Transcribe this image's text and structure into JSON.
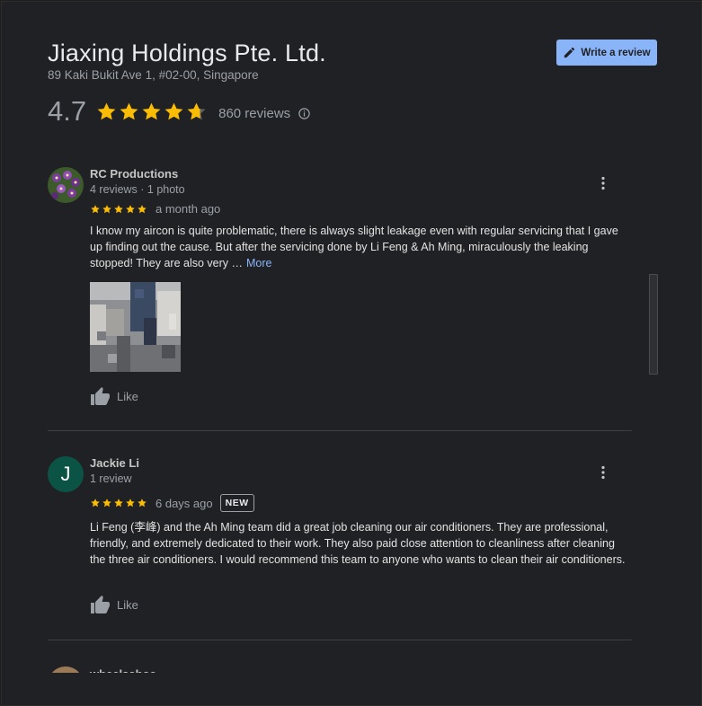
{
  "business": {
    "name": "Jiaxing Holdings Pte. Ltd.",
    "address": "89 Kaki Bukit Ave 1, #02-00, Singapore",
    "rating": "4.7",
    "rating_value": 4.7,
    "review_count": "860 reviews",
    "write_review_label": "Write a review"
  },
  "colors": {
    "star": "#fbbc04",
    "accent": "#8ab4f8",
    "background": "#202124"
  },
  "reviews": [
    {
      "name": "RC Productions",
      "meta": "4 reviews · 1 photo",
      "stars": 5,
      "date": "a month ago",
      "text": "I know my aircon is quite problematic, there is always slight leakage even with regular servicing that I gave up finding out the cause. But after the servicing done by Li Feng & Ah Ming, miraculously the leaking stopped! They are also very …",
      "more_label": "More",
      "like_label": "Like",
      "avatar": "flower-photo"
    },
    {
      "name": "Jackie Li",
      "meta": "1 review",
      "stars": 5,
      "date": "6 days ago",
      "badge": "NEW",
      "avatar_letter": "J",
      "text": "Li Feng (李峰) and the Ah Ming team did a great job cleaning our air conditioners. They are professional, friendly, and extremely dedicated to their work. They also paid close attention to cleanliness after cleaning the three air conditioners. I would recommend this team to anyone who wants to clean their air conditioners.",
      "like_label": "Like"
    },
    {
      "name": "wheelsahoe"
    }
  ],
  "icons": {
    "write": "pencil-icon",
    "info": "info-icon",
    "menu": "more-vert-icon",
    "like": "thumb-up-icon",
    "star": "star-icon"
  }
}
